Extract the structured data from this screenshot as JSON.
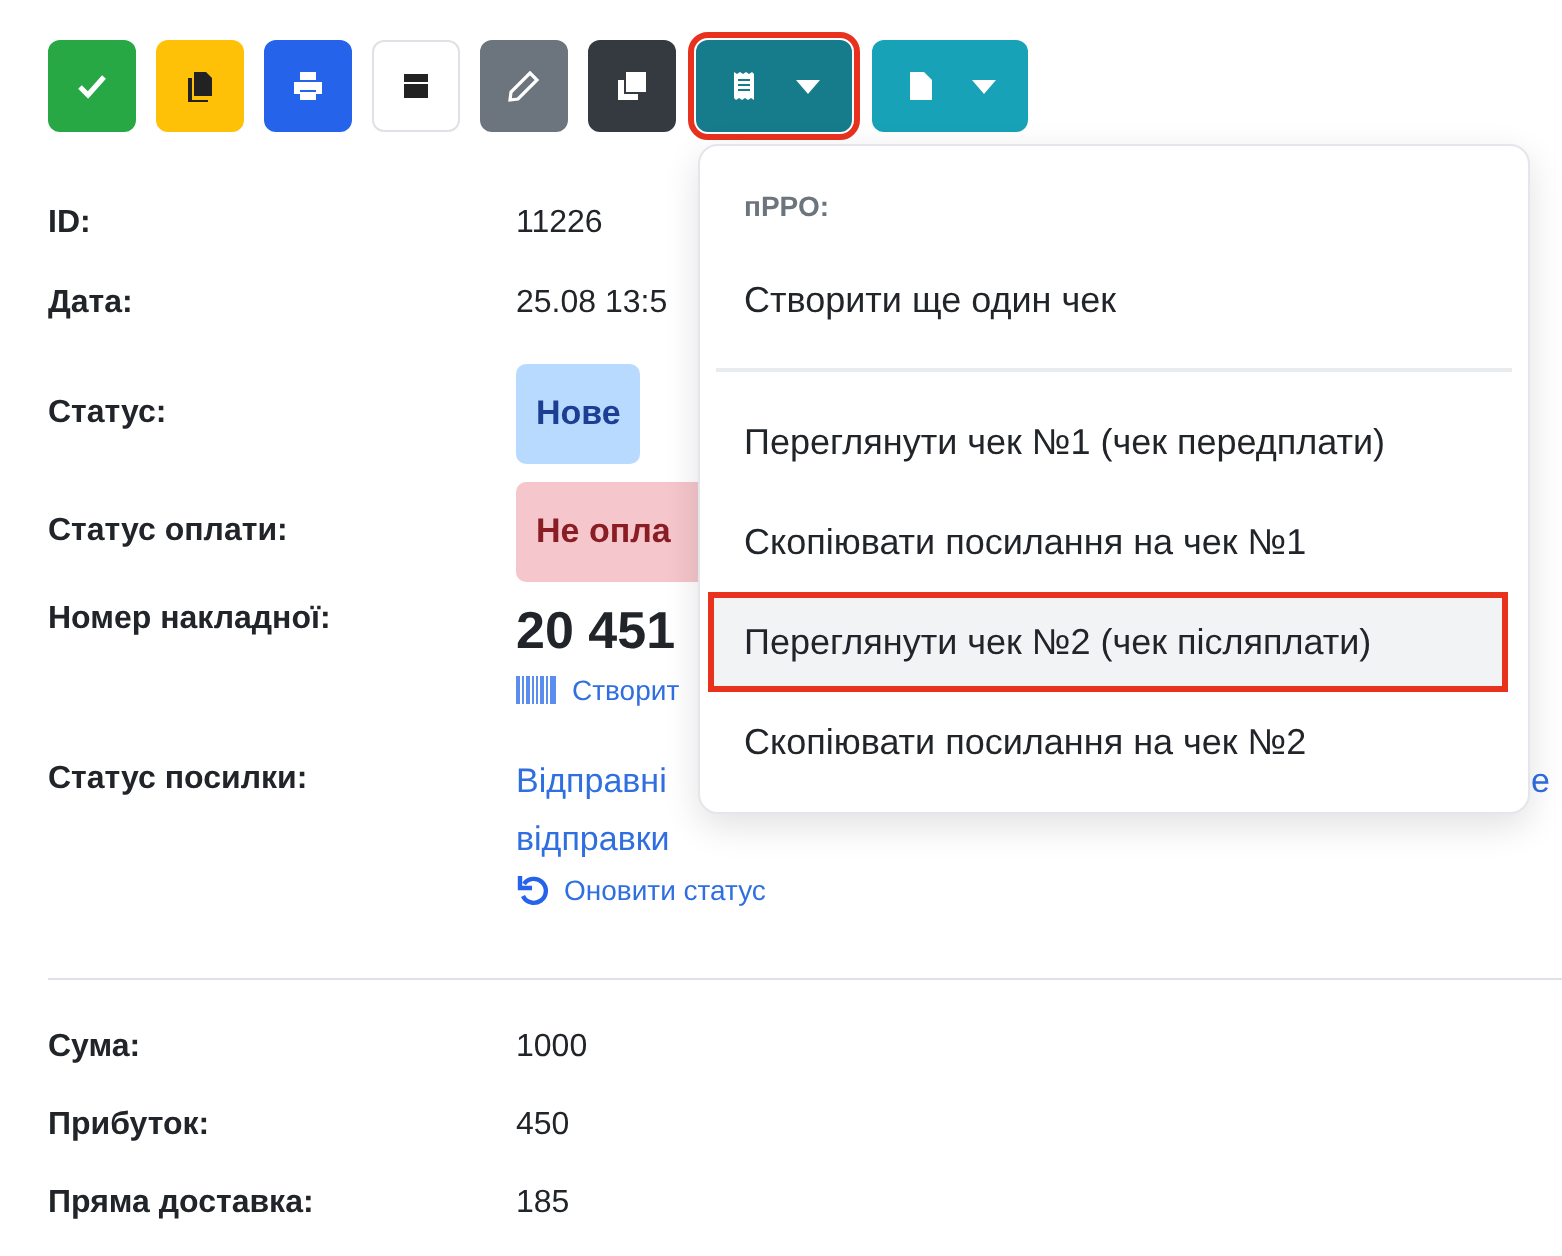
{
  "toolbar": [
    {
      "kind": "check",
      "color": "#28a745",
      "dropdown": false,
      "highlighted": false
    },
    {
      "kind": "copy",
      "color": "#ffc107",
      "dropdown": false,
      "highlighted": false
    },
    {
      "kind": "print",
      "color": "#2563eb",
      "dropdown": false,
      "highlighted": false
    },
    {
      "kind": "box",
      "color": "#ffffff",
      "dropdown": false,
      "highlighted": false
    },
    {
      "kind": "pencil",
      "color": "#6c757d",
      "dropdown": false,
      "highlighted": false
    },
    {
      "kind": "clone",
      "color": "#343a40",
      "dropdown": false,
      "highlighted": false
    },
    {
      "kind": "receipt",
      "color": "#167c8c",
      "dropdown": true,
      "highlighted": true
    },
    {
      "kind": "file",
      "color": "#17a2b8",
      "dropdown": true,
      "highlighted": false
    }
  ],
  "details": [
    {
      "kind": "text",
      "label": "ID:",
      "value": "11226"
    },
    {
      "kind": "text",
      "label": "Дата:",
      "value": "25.08 13:5"
    },
    {
      "kind": "badge",
      "label": "Статус:",
      "value": "Нове",
      "color": "#b8daff"
    },
    {
      "kind": "badge",
      "label": "Статус оплати:",
      "value": "Не опла",
      "color": "#f5c6cb"
    },
    {
      "kind": "waybill",
      "label": "Номер накладної:",
      "value": "20 451",
      "link": "Створит"
    },
    {
      "kind": "tracking",
      "label": "Статус посилки:",
      "value": "Відправні",
      "tail": "е",
      "value_line_2": "відправки",
      "link": "Оновити статус"
    }
  ],
  "totals": [
    {
      "label": "Сума:",
      "value": "1000"
    },
    {
      "label": "Прибуток:",
      "value": "450"
    },
    {
      "label": "Пряма доставка:",
      "value": "185"
    }
  ],
  "menu": {
    "header": "пРРО:",
    "groups": [
      {
        "items": [
          {
            "label": "Створити ще один чек",
            "selected": false
          }
        ]
      },
      {
        "items": [
          {
            "label": "Переглянути чек №1 (чек передплати)",
            "selected": false
          },
          {
            "label": "Скопіювати посилання на чек №1",
            "selected": false
          },
          {
            "label": "Переглянути чек №2 (чек післяплати)",
            "selected": true
          },
          {
            "label": "Скопіювати посилання на чек №2",
            "selected": false
          }
        ]
      }
    ]
  }
}
